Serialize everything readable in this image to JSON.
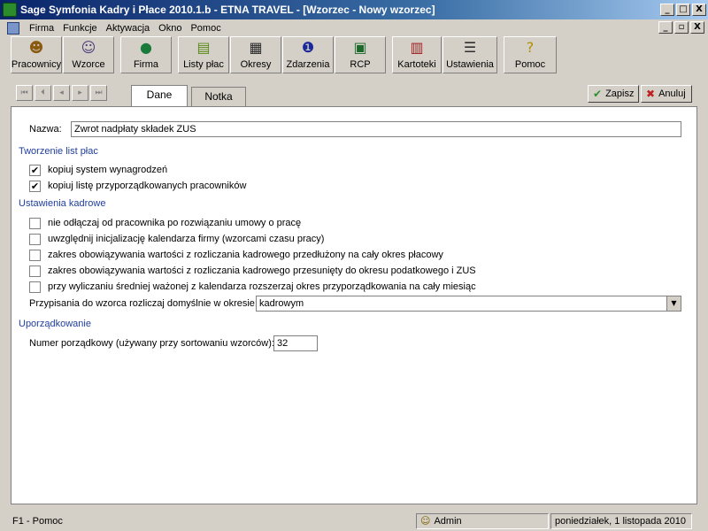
{
  "window": {
    "title": "Sage Symfonia Kadry i Płace 2010.1.b - ETNA TRAVEL - [Wzorzec - Nowy wzorzec]",
    "btn_minimize": "_",
    "btn_maximize": "□",
    "btn_close": "X",
    "btn_restore": "▫"
  },
  "menu": {
    "items": [
      "Firma",
      "Funkcje",
      "Aktywacja",
      "Okno",
      "Pomoc"
    ]
  },
  "toolbar": {
    "buttons": [
      "Pracownicy",
      "Wzorce",
      "Firma",
      "Listy płac",
      "Okresy",
      "Zdarzenia",
      "RCP",
      "Kartoteki",
      "Ustawienia",
      "Pomoc"
    ],
    "icons": [
      "people-icon",
      "template-icon",
      "globe-icon",
      "money-icon",
      "calendar-icon",
      "info-icon",
      "rcp-icon",
      "files-icon",
      "sliders-icon",
      "help-icon"
    ]
  },
  "nav": {
    "first": "⏮",
    "prev_page": "⏴",
    "prev": "◂",
    "next": "▸",
    "last": "⏭"
  },
  "tabs": [
    "Dane",
    "Notka"
  ],
  "actions": {
    "save": "Zapisz",
    "cancel": "Anuluj",
    "save_color": "#2f8f2f",
    "cancel_color": "#c02020"
  },
  "form": {
    "name_label": "Nazwa:",
    "name_value": "Zwrot nadpłaty składek ZUS",
    "section_payroll": "Tworzenie list płac",
    "payroll_options": [
      {
        "label": "kopiuj system wynagrodzeń",
        "checked": true
      },
      {
        "label": "kopiuj listę przyporządkowanych pracowników",
        "checked": true
      }
    ],
    "section_hr": "Ustawienia kadrowe",
    "hr_options": [
      {
        "label": "nie odłączaj od pracownika po rozwiązaniu umowy o pracę",
        "checked": false
      },
      {
        "label": "uwzględnij inicjalizację kalendarza firmy (wzorcami czasu pracy)",
        "checked": false
      },
      {
        "label": "zakres obowiązywania wartości z rozliczania kadrowego przedłużony na cały okres płacowy",
        "checked": false
      },
      {
        "label": "zakres obowiązywania wartości z rozliczania kadrowego przesunięty do okresu podatkowego i ZUS",
        "checked": false
      },
      {
        "label": "przy wyliczaniu średniej ważonej z kalendarza rozszerzaj okres przyporządkowania na cały miesiąc",
        "checked": false
      }
    ],
    "assign_label": "Przypisania do wzorca rozliczaj domyślnie w okresie:",
    "assign_value": "kadrowym",
    "section_order": "Uporządkowanie",
    "order_label": "Numer porządkowy (używany przy sortowaniu wzorców):",
    "order_value": "32",
    "accent": "#1f3e9e",
    "check_glyph": "✔"
  },
  "status": {
    "help": "F1 - Pomoc",
    "user": "Admin",
    "date": "poniedziałek, 1 listopada 2010"
  }
}
